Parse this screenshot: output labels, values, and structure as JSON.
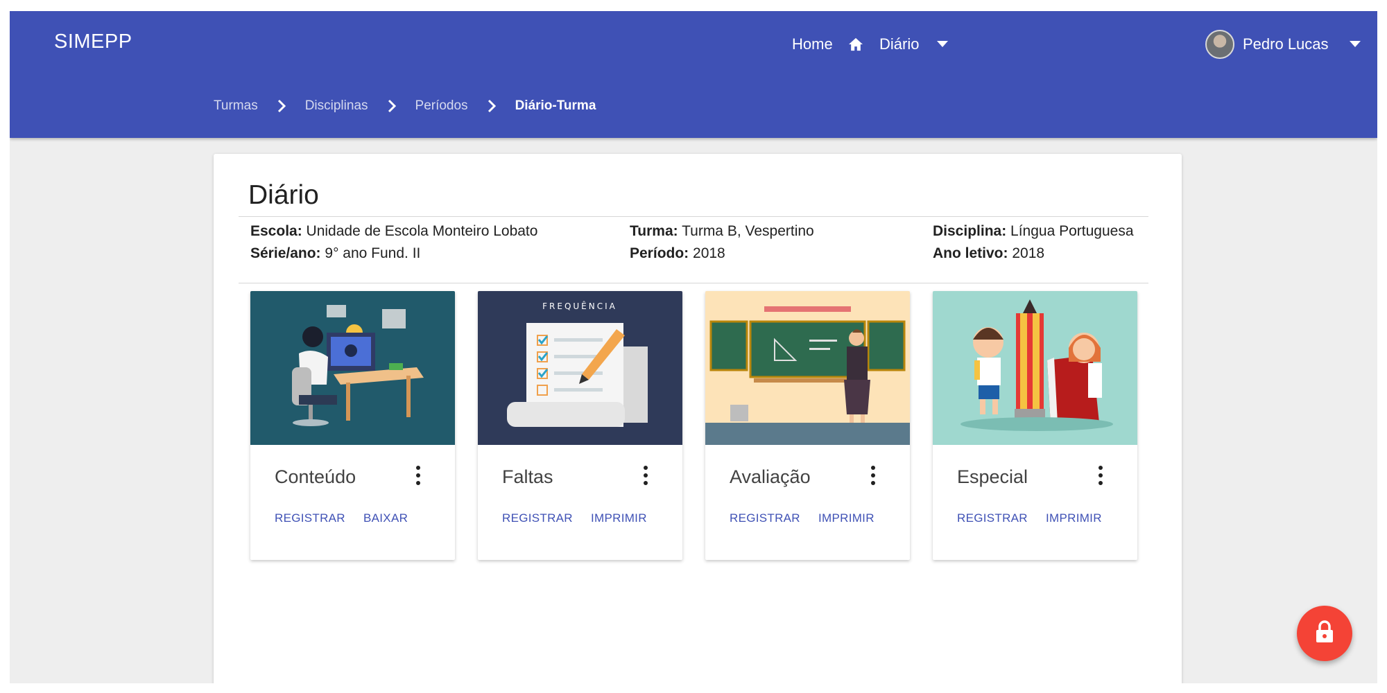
{
  "navbar": {
    "brand": "SIMEPP",
    "home_label": "Home",
    "diario_label": "Diário",
    "user_name": "Pedro Lucas",
    "color": "#3f51b5"
  },
  "breadcrumb": [
    "Turmas",
    "Disciplinas",
    "Períodos",
    "Diário-Turma"
  ],
  "page": {
    "title": "Diário",
    "info": {
      "escola_label": "Escola:",
      "escola_value": "Unidade de Escola Monteiro Lobato",
      "serie_label": "Série/ano:",
      "serie_value": "9° ano Fund. II",
      "turma_label": "Turma:",
      "turma_value": "Turma B, Vespertino",
      "periodo_label": "Período:",
      "periodo_value": "2018",
      "disciplina_label": "Disciplina:",
      "disciplina_value": "Língua Portuguesa",
      "ano_label": "Ano letivo:",
      "ano_value": "2018"
    }
  },
  "cards": [
    {
      "title": "Conteúdo",
      "action1": "REGISTRAR",
      "action2": "BAIXAR"
    },
    {
      "title": "Faltas",
      "image_caption": "FREQUÊNCIA",
      "action1": "REGISTRAR",
      "action2": "IMPRIMIR"
    },
    {
      "title": "Avaliação",
      "action1": "REGISTRAR",
      "action2": "IMPRIMIR"
    },
    {
      "title": "Especial",
      "action1": "REGISTRAR",
      "action2": "IMPRIMIR"
    }
  ],
  "icons": {
    "home": "home-icon",
    "dropdown": "arrow-drop-down-icon",
    "chevron": "chevron-right-icon",
    "more": "more-vert-icon",
    "lock": "lock-icon"
  },
  "accent_colors": {
    "primary": "#3f51b5",
    "fab": "#f44336"
  }
}
